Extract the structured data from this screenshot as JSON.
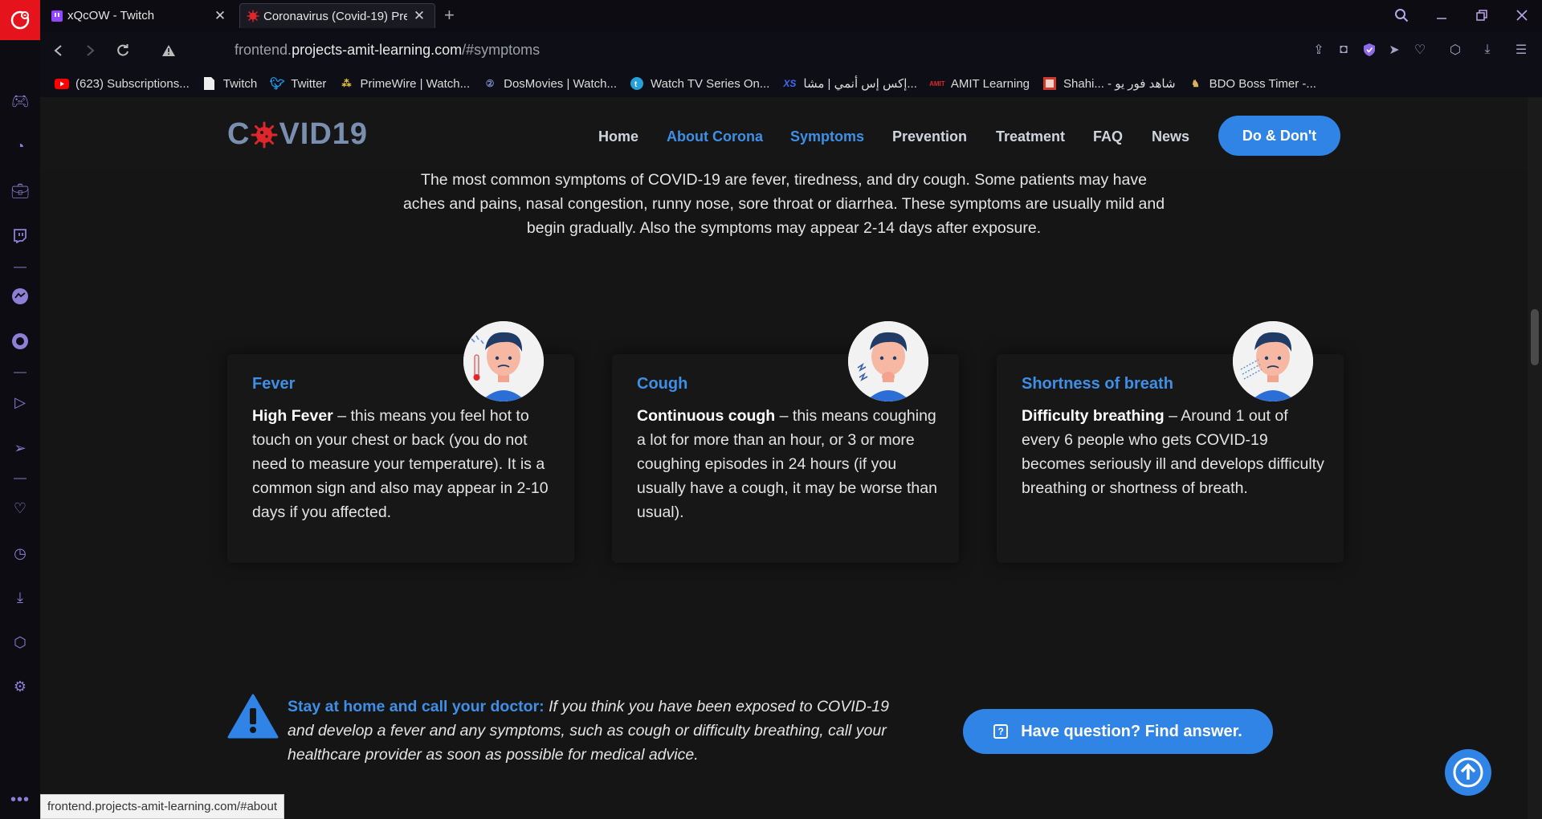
{
  "browser": {
    "tabs": [
      {
        "title": "xQcOW - Twitch",
        "active": false
      },
      {
        "title": "Coronavirus (Covid-19) Pre",
        "active": true
      }
    ],
    "url_host": "frontend.",
    "url_domain": "projects-amit-learning.com",
    "url_path": "/#symptoms",
    "bookmarks": [
      {
        "label": "(623) Subscriptions...",
        "icon": "youtube-icon"
      },
      {
        "label": "Twitch",
        "icon": "page-icon"
      },
      {
        "label": "Twitter",
        "icon": "twitter-icon"
      },
      {
        "label": "PrimeWire | Watch...",
        "icon": "primewire-icon"
      },
      {
        "label": "DosMovies | Watch...",
        "icon": "dosmovies-icon"
      },
      {
        "label": "Watch TV Series On...",
        "icon": "tvseries-icon"
      },
      {
        "label": "إكس إس أنمي | مشا...",
        "icon": "xs-icon"
      },
      {
        "label": "AMIT Learning",
        "icon": "amit-icon"
      },
      {
        "label": "Shahi... - شاهد فور يو",
        "icon": "shahid-icon"
      },
      {
        "label": "BDO Boss Timer -...",
        "icon": "bdo-icon"
      }
    ],
    "status_url": "frontend.projects-amit-learning.com/#about"
  },
  "site": {
    "brand_left": "C",
    "brand_right": "VID19",
    "nav": [
      {
        "label": "Home",
        "active": false
      },
      {
        "label": "About Corona",
        "active": true
      },
      {
        "label": "Symptoms",
        "active": true
      },
      {
        "label": "Prevention",
        "active": false
      },
      {
        "label": "Treatment",
        "active": false
      },
      {
        "label": "FAQ",
        "active": false
      },
      {
        "label": "News",
        "active": false
      }
    ],
    "cta": "Do & Don't"
  },
  "symptoms": {
    "intro": "The most common symptoms of COVID-19 are fever, tiredness, and dry cough. Some patients may have aches and pains, nasal congestion, runny nose, sore throat or diarrhea. These symptoms are usually mild and begin gradually. Also the symptoms may appear 2-14 days after exposure.",
    "cards": [
      {
        "title": "Fever",
        "lead": "High Fever",
        "text": " – this means you feel hot to touch on your chest or back (you do not need to measure your temperature). It is a common sign and also may appear in 2-10 days if you affected."
      },
      {
        "title": "Cough",
        "lead": "Continuous cough",
        "text": " – this means coughing a lot for more than an hour, or 3 or more coughing episodes in 24 hours (if you usually have a cough, it may be worse than usual)."
      },
      {
        "title": "Shortness of breath",
        "lead": "Difficulty breathing",
        "text": " – Around 1 out of every 6 people who gets COVID-19 becomes seriously ill and develops difficulty breathing or shortness of breath."
      }
    ]
  },
  "advice": {
    "title": "Stay at home and call your doctor:",
    "text": " If you think you have been exposed to COVID-19 and develop a fever and any symptoms, such as cough or difficulty breathing, call your healthcare provider as soon as possible for medical advice."
  },
  "question_button": "Have question? Find answer.",
  "colors": {
    "accent": "#2f84e5",
    "link": "#3f8fe6",
    "background": "#151515",
    "brand_virus": "#e0262b"
  }
}
